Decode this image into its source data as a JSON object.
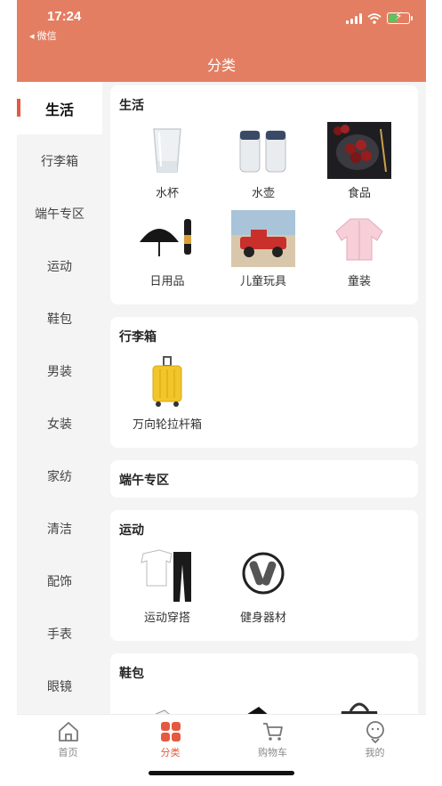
{
  "status_bar": {
    "time": "17:24",
    "back_label": "◂ 微信"
  },
  "header": {
    "title": "分类"
  },
  "sidebar": {
    "items": [
      {
        "label": "生活",
        "active": true
      },
      {
        "label": "行李箱"
      },
      {
        "label": "端午专区"
      },
      {
        "label": "运动"
      },
      {
        "label": "鞋包"
      },
      {
        "label": "男装"
      },
      {
        "label": "女装"
      },
      {
        "label": "家纺"
      },
      {
        "label": "清洁"
      },
      {
        "label": "配饰"
      },
      {
        "label": "手表"
      },
      {
        "label": "眼镜"
      }
    ]
  },
  "sections": [
    {
      "title": "生活",
      "items": [
        {
          "label": "水杯",
          "icon": "glass-cup-image"
        },
        {
          "label": "水壶",
          "icon": "kettle-image"
        },
        {
          "label": "食品",
          "icon": "food-image"
        },
        {
          "label": "日用品",
          "icon": "umbrella-image"
        },
        {
          "label": "儿童玩具",
          "icon": "toy-car-image"
        },
        {
          "label": "童装",
          "icon": "kids-jacket-image"
        }
      ]
    },
    {
      "title": "行李箱",
      "items": [
        {
          "label": "万向轮拉杆箱",
          "icon": "suitcase-image"
        }
      ]
    },
    {
      "title": "端午专区",
      "items": []
    },
    {
      "title": "运动",
      "items": [
        {
          "label": "运动穿搭",
          "icon": "sportswear-image"
        },
        {
          "label": "健身器材",
          "icon": "jump-rope-image"
        }
      ]
    },
    {
      "title": "鞋包",
      "items": [
        {
          "label": "",
          "icon": "sneaker-image"
        },
        {
          "label": "",
          "icon": "black-shoe-image"
        },
        {
          "label": "",
          "icon": "handbag-image"
        }
      ]
    }
  ],
  "tabbar": {
    "tabs": [
      {
        "label": "首页",
        "icon": "home-icon"
      },
      {
        "label": "分类",
        "icon": "category-icon",
        "active": true
      },
      {
        "label": "购物车",
        "icon": "cart-icon"
      },
      {
        "label": "我的",
        "icon": "profile-icon"
      }
    ]
  },
  "colors": {
    "header": "#e47e62",
    "accent": "#e4593f",
    "sidebar_bg": "#f4f4f4"
  }
}
